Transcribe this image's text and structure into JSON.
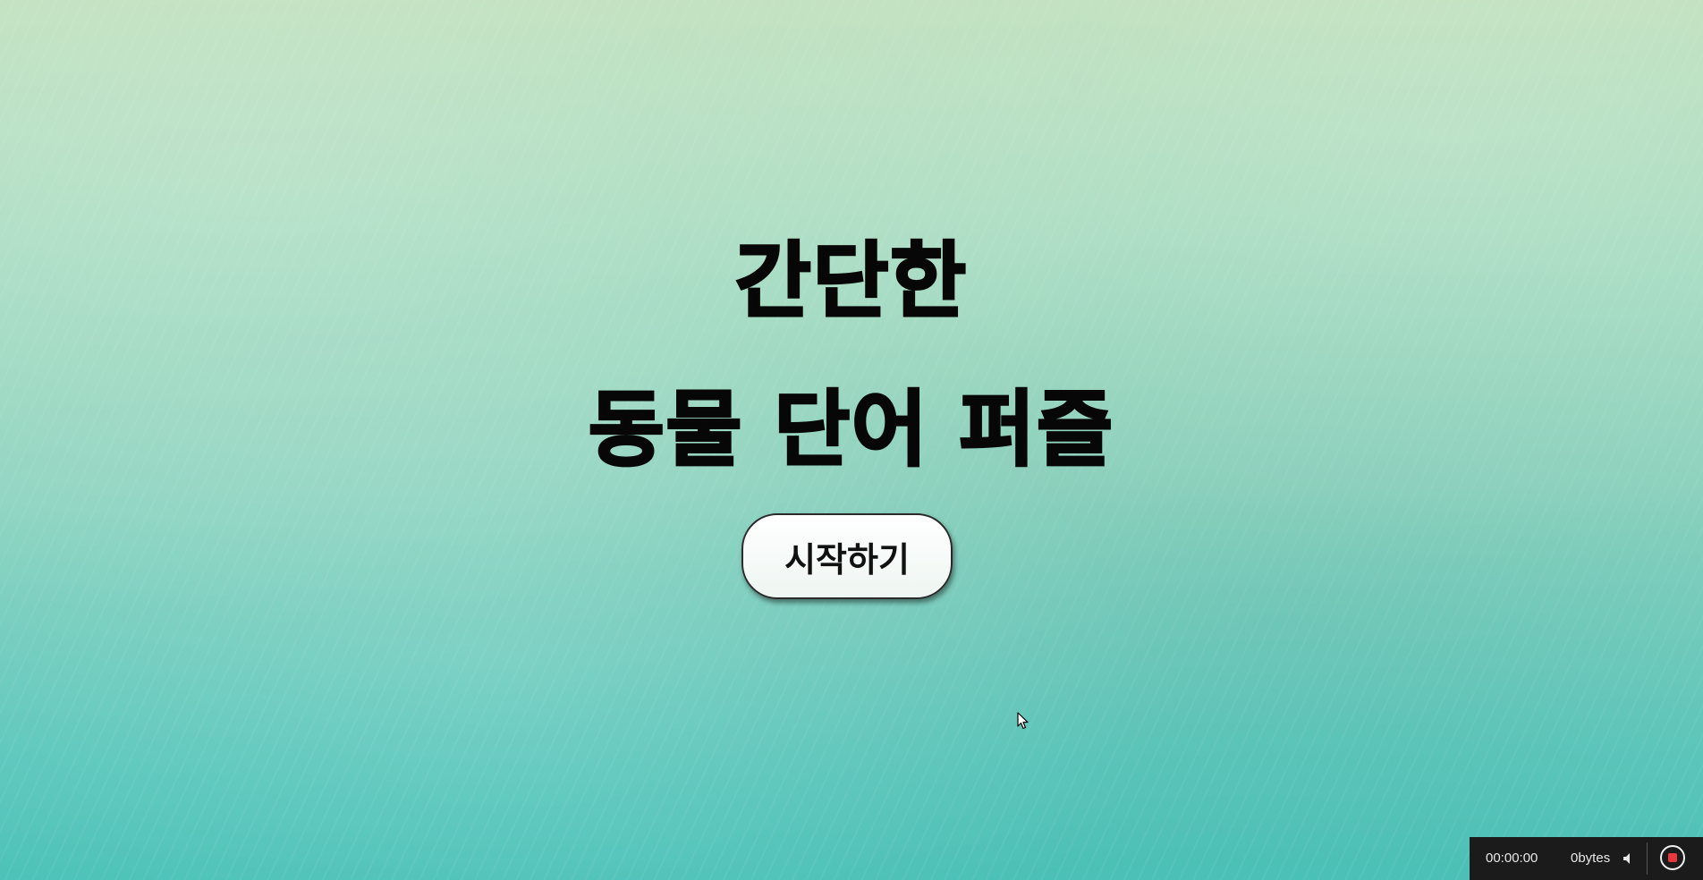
{
  "page": {
    "title_line1": "간단한",
    "title_line2": "동물 단어 퍼즐",
    "start_button_label": "시작하기"
  },
  "recorder": {
    "elapsed_time": "00:00:00",
    "file_size": "0bytes",
    "volume_icon": "speaker-icon",
    "stop_icon": "record-stop-icon",
    "stop_color": "#e8383d"
  },
  "colors": {
    "background_top": "#bfe0bd",
    "background_bottom": "#4cc2b8",
    "title_text": "#070707"
  }
}
